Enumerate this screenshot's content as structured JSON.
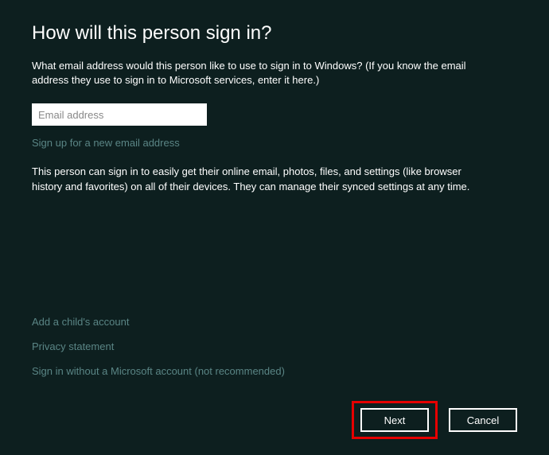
{
  "title": "How will this person sign in?",
  "intro_text": "What email address would this person like to use to sign in to Windows? (If you know the email address they use to sign in to Microsoft services, enter it here.)",
  "email_input": {
    "placeholder": "Email address",
    "value": ""
  },
  "signup_link": "Sign up for a new email address",
  "description_text": "This person can sign in to easily get their online email, photos, files, and settings (like browser history and favorites) on all of their devices. They can manage their synced settings at any time.",
  "bottom_links": {
    "add_child": "Add a child's account",
    "privacy": "Privacy statement",
    "no_account": "Sign in without a Microsoft account (not recommended)"
  },
  "buttons": {
    "next": "Next",
    "cancel": "Cancel"
  }
}
